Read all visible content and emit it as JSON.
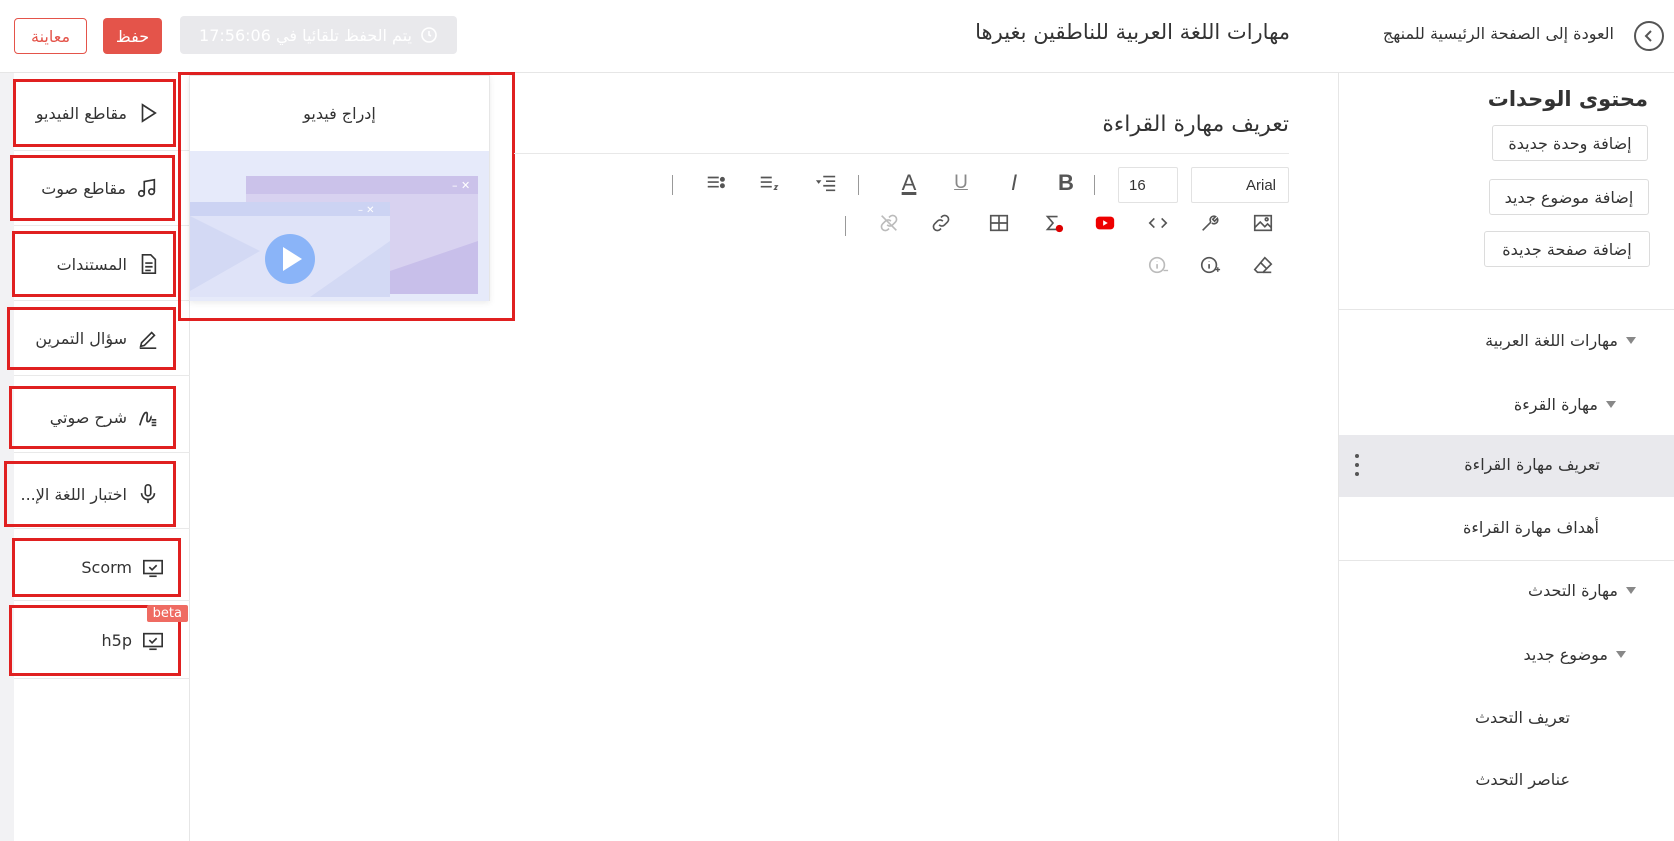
{
  "header": {
    "back_label": "العودة إلى الصفحة الرئيسية للمنهج",
    "course_title": "مهارات اللغة العربية للناطقين بغيرها",
    "autosave_text": "يتم الحفظ تلقائيا في 17:56:06",
    "save_label": "حفظ",
    "preview_label": "معاينة"
  },
  "tools": {
    "items": [
      {
        "label": "مقاطع الفيديو",
        "icon": "play-icon"
      },
      {
        "label": "مقاطع صوت",
        "icon": "music-note-icon"
      },
      {
        "label": "المستندات",
        "icon": "document-icon"
      },
      {
        "label": "سؤال التمرين",
        "icon": "pencil-icon"
      },
      {
        "label": "شرح صوتي",
        "icon": "audio-explanation-icon"
      },
      {
        "label": "اختبار اللغة الإ...",
        "icon": "microphone-icon"
      },
      {
        "label": "Scorm",
        "icon": "monitor-check-icon"
      },
      {
        "label": "h5p",
        "icon": "monitor-check-icon"
      }
    ],
    "beta_badge": "beta"
  },
  "video_popover": {
    "title": "إدراج فيديو"
  },
  "editor": {
    "page_heading": "تعريف مهارة القراءة",
    "font_family": "Arial",
    "font_size": "16",
    "toolbar_glyphs": {
      "bold": "B",
      "italic": "I",
      "underline": "U",
      "font_color": "A"
    }
  },
  "units": {
    "title": "محتوى الوحدات",
    "add_unit": "إضافة وحدة جديدة",
    "add_topic": "إضافة موضوع جديد",
    "add_page": "إضافة صفحة جديدة",
    "tree": [
      {
        "label": "مهارات اللغة العربية",
        "expandable": true
      },
      {
        "label": "مهارة القرءة",
        "expandable": true
      },
      {
        "label": "تعريف مهارة القراءة",
        "active": true
      },
      {
        "label": "أهداف مهارة القراءة"
      },
      {
        "label": "مهارة التحدث",
        "expandable": true
      },
      {
        "label": "موضوع جديد",
        "expandable": true
      },
      {
        "label": "تعريف التحدث"
      },
      {
        "label": "عناصر التحدث"
      }
    ]
  },
  "colors": {
    "accent": "#e4544a",
    "highlight_border": "#e02020",
    "active_row": "#e9e9ed"
  }
}
